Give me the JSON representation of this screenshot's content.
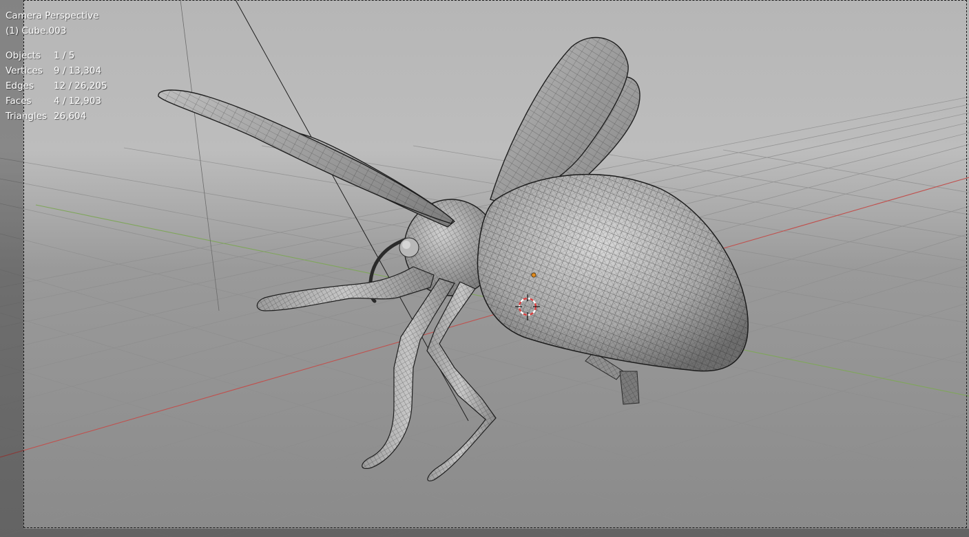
{
  "viewport": {
    "view_name": "Camera Perspective",
    "active_object": "(1) Cube.003",
    "stats": [
      {
        "label": "Objects",
        "value": "1 / 5"
      },
      {
        "label": "Vertices",
        "value": "9 / 13,304"
      },
      {
        "label": "Edges",
        "value": "12 / 26,205"
      },
      {
        "label": "Faces",
        "value": "4 / 12,903"
      },
      {
        "label": "Triangles",
        "value": "26,604"
      }
    ]
  },
  "colors": {
    "x_axis": "#c0504d",
    "y_axis": "#7fa65a",
    "grid": "#8c8c8c",
    "mesh_fill": "#a6a6a6",
    "wire": "#2a2a2a",
    "origin_dot": "#e08a1e",
    "cursor_red": "#d83a3a"
  },
  "icons": {
    "cursor": "3d-cursor-icon",
    "origin": "object-origin-icon"
  }
}
